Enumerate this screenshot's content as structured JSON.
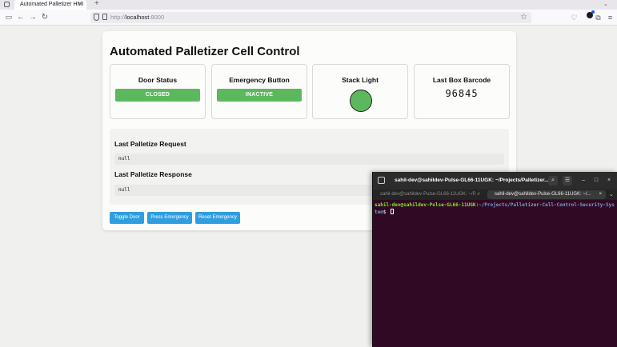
{
  "browser": {
    "tab_title": "Automated Palletizer HMI",
    "tab_close": "×",
    "new_tab": "+",
    "tab_overflow": "⌄",
    "url_prefix": "http://",
    "url_host": "localhost",
    "url_suffix": ":8000",
    "icons": {
      "back": "←",
      "forward": "→",
      "reload": "↻",
      "bookmark": "☆",
      "pocket": "♡",
      "extensions": "⧉",
      "menu": "≡"
    }
  },
  "page": {
    "title": "Automated Palletizer Cell Control",
    "status_cards": {
      "door": {
        "title": "Door Status",
        "value": "CLOSED"
      },
      "emergency": {
        "title": "Emergency Button",
        "value": "INACTIVE"
      },
      "stack_light": {
        "title": "Stack Light",
        "color": "#5cb85c"
      },
      "barcode": {
        "title": "Last Box Barcode",
        "value": "96845"
      }
    },
    "request": {
      "heading": "Last Palletize Request",
      "value": "null"
    },
    "response": {
      "heading": "Last Palletize Response",
      "value": "null"
    },
    "buttons": {
      "toggle_door": "Toggle Door",
      "press_emergency": "Press Emergency",
      "reset_emergency": "Reset Emergency"
    },
    "colors": {
      "ok": "#5cb85c",
      "button": "#2e9ee0"
    }
  },
  "terminal": {
    "title": "sahil-dev@sahildev-Pulse-GL66-11UGK: ~/Projects/Palletizer...",
    "search_icon": "⌕",
    "menu_icon": "☰",
    "minimize": "–",
    "maximize": "□",
    "close": "×",
    "tabs": [
      {
        "label": "sahil-dev@sahildev-Pulse-GL66-11UGK: ~/P...",
        "close": "×"
      },
      {
        "label": "sahil-dev@sahildev-Pulse-GL66-11UGK: ~/...",
        "close": "×"
      }
    ],
    "tabs_menu": "⌄",
    "prompt_user": "sahil-dev@sahildev-Pulse-GL66-11UGK",
    "prompt_sep": ":",
    "prompt_path": "~/Projects/Palletizer-Cell-Control-Security-System",
    "prompt_symbol": "$ "
  }
}
